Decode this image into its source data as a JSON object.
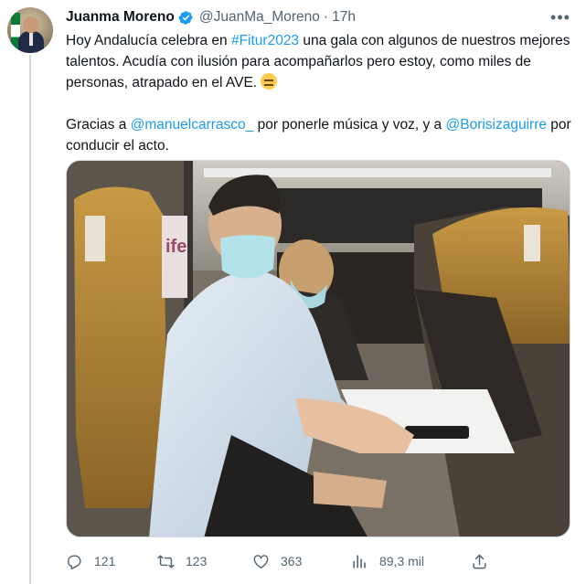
{
  "tweet": {
    "author_name": "Juanma Moreno",
    "handle": "@JuanMa_Moreno",
    "separator": "·",
    "time": "17h",
    "text": {
      "line1_pre": "Hoy Andalucía celebra en ",
      "hashtag": "#Fitur2023",
      "line1_post": " una gala con algunos de nuestros mejores talentos. Acudía con ilusión para acompañarlos pero estoy, como miles de personas, atrapado en el AVE. ",
      "emoji": "tired-face-emoji",
      "line2_pre": "Gracias a ",
      "mention1": "@manuelcarrasco_",
      "line2_mid": " por ponerle música y voz, y  a ",
      "mention2": "@Borisizaguirre",
      "line2_post": " por conducir el acto."
    },
    "photo": {
      "description_icon": "train-photo"
    },
    "stats": {
      "replies": "121",
      "retweets": "123",
      "likes": "363",
      "views": "89,3 mil"
    }
  },
  "colors": {
    "link": "#1d9bf0",
    "secondary_text": "#536471",
    "verified": "#1d9bf0"
  }
}
